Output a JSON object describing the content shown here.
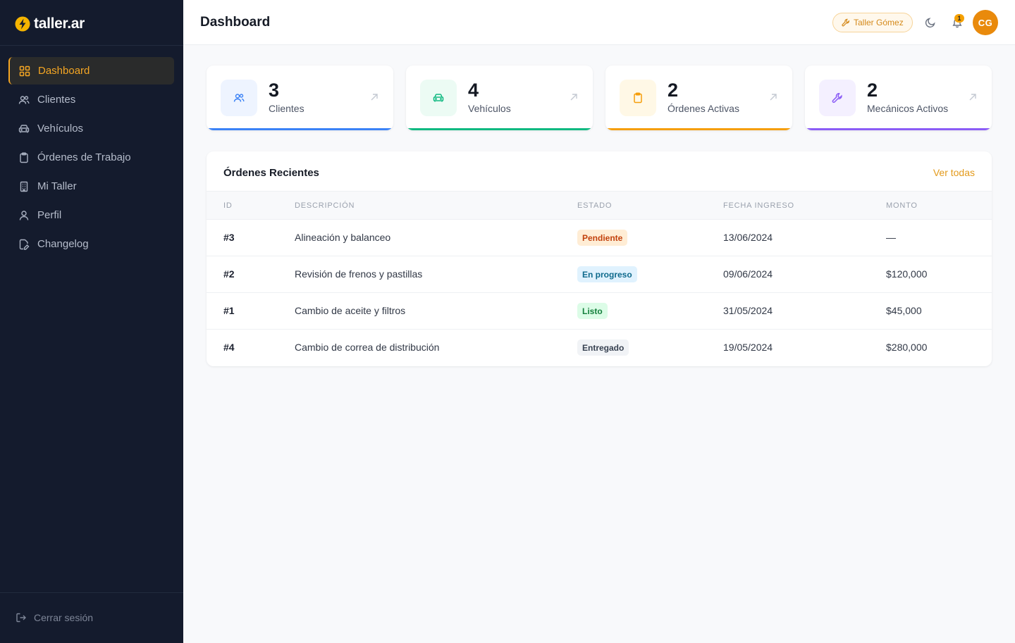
{
  "brand": {
    "name": "taller.ar",
    "accent": "#f5a623"
  },
  "sidebar": {
    "items": [
      {
        "label": "Dashboard",
        "icon": "grid-icon",
        "active": true
      },
      {
        "label": "Clientes",
        "icon": "users-icon"
      },
      {
        "label": "Vehículos",
        "icon": "car-icon"
      },
      {
        "label": "Órdenes de Trabajo",
        "icon": "clipboard-icon"
      },
      {
        "label": "Mi Taller",
        "icon": "building-icon"
      },
      {
        "label": "Perfil",
        "icon": "user-icon"
      },
      {
        "label": "Changelog",
        "icon": "file-edit-icon"
      }
    ],
    "logout_label": "Cerrar sesión"
  },
  "header": {
    "title": "Dashboard",
    "workshop_label": "Taller Gómez",
    "notification_count": "1",
    "avatar_initials": "CG"
  },
  "stats": [
    {
      "value": "3",
      "label": "Clientes",
      "icon": "users-icon",
      "color": "#3b82f6",
      "bg": "#eef4ff"
    },
    {
      "value": "4",
      "label": "Vehículos",
      "icon": "car-icon",
      "color": "#10b981",
      "bg": "#ecfbf4"
    },
    {
      "value": "2",
      "label": "Órdenes Activas",
      "icon": "clipboard-icon",
      "color": "#f59e0b",
      "bg": "#fff8e6"
    },
    {
      "value": "2",
      "label": "Mecánicos Activos",
      "icon": "wrench-icon",
      "color": "#8b5cf6",
      "bg": "#f4f0ff"
    }
  ],
  "orders": {
    "title": "Órdenes Recientes",
    "view_all": "Ver todas",
    "columns": [
      "ID",
      "DESCRIPCIÓN",
      "ESTADO",
      "FECHA INGRESO",
      "MONTO"
    ],
    "rows": [
      {
        "id": "#3",
        "description": "Alineación y balanceo",
        "status": "Pendiente",
        "status_color": "#c2410c",
        "status_bg": "#ffedd5",
        "date": "13/06/2024",
        "amount": "—"
      },
      {
        "id": "#2",
        "description": "Revisión de frenos y pastillas",
        "status": "En progreso",
        "status_color": "#0e6a8c",
        "status_bg": "#e0f2fe",
        "date": "09/06/2024",
        "amount": "$120,000"
      },
      {
        "id": "#1",
        "description": "Cambio de aceite y filtros",
        "status": "Listo",
        "status_color": "#15803d",
        "status_bg": "#dcfce7",
        "date": "31/05/2024",
        "amount": "$45,000"
      },
      {
        "id": "#4",
        "description": "Cambio de correa de distribución",
        "status": "Entregado",
        "status_color": "#374151",
        "status_bg": "#f1f3f6",
        "date": "19/05/2024",
        "amount": "$280,000"
      }
    ]
  }
}
